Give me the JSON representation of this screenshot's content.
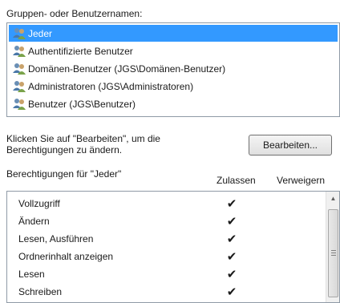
{
  "groups_label": "Gruppen- oder Benutzernamen:",
  "users": [
    {
      "name": "Jeder",
      "selected": true
    },
    {
      "name": "Authentifizierte Benutzer",
      "selected": false
    },
    {
      "name": "Domänen-Benutzer (JGS\\Domänen-Benutzer)",
      "selected": false
    },
    {
      "name": "Administratoren (JGS\\Administratoren)",
      "selected": false
    },
    {
      "name": "Benutzer (JGS\\Benutzer)",
      "selected": false
    }
  ],
  "hint": {
    "line1": "Klicken Sie auf \"Bearbeiten\", um die",
    "line2": "Berechtigungen zu ändern."
  },
  "edit_button": "Bearbeiten...",
  "permissions_header": "Berechtigungen für \"Jeder\"",
  "columns": {
    "allow": "Zulassen",
    "deny": "Verweigern"
  },
  "permissions": [
    {
      "name": "Vollzugriff",
      "allow": "✔",
      "deny": ""
    },
    {
      "name": "Ändern",
      "allow": "✔",
      "deny": ""
    },
    {
      "name": "Lesen, Ausführen",
      "allow": "✔",
      "deny": ""
    },
    {
      "name": "Ordnerinhalt anzeigen",
      "allow": "✔",
      "deny": ""
    },
    {
      "name": "Lesen",
      "allow": "✔",
      "deny": ""
    },
    {
      "name": "Schreiben",
      "allow": "✔",
      "deny": ""
    }
  ],
  "icon": "user-group-icon",
  "colors": {
    "selection": "#3399ff"
  }
}
